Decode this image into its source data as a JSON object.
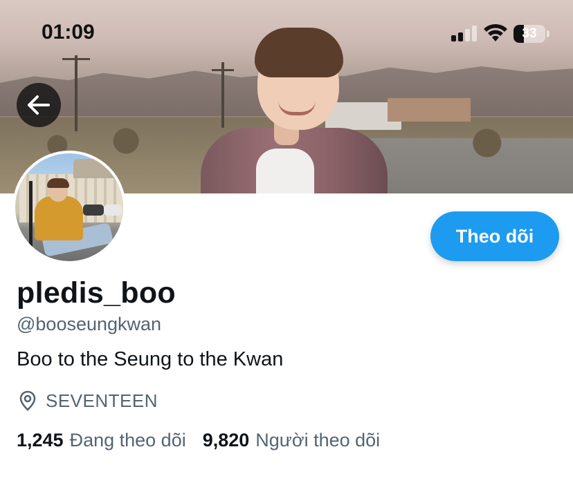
{
  "status_bar": {
    "time": "01:09",
    "battery_level": "33",
    "battery_fraction": 0.33,
    "signal_bars_active": 2,
    "signal_bars_total": 4
  },
  "banner": {
    "description_icon": "cover-photo"
  },
  "nav": {
    "back_icon": "arrow-left-icon"
  },
  "profile": {
    "display_name": "pledis_boo",
    "handle": "@booseungkwan",
    "bio": "Boo to the Seung to the Kwan",
    "location_icon": "location-pin-icon",
    "location": "SEVENTEEN"
  },
  "actions": {
    "follow_label": "Theo dõi"
  },
  "stats": {
    "following_count": "1,245",
    "following_label": "Đang theo dõi",
    "followers_count": "9,820",
    "followers_label": "Người theo dõi"
  },
  "colors": {
    "accent": "#1d9bf0",
    "text_primary": "#0f1419",
    "text_secondary": "#536471"
  }
}
